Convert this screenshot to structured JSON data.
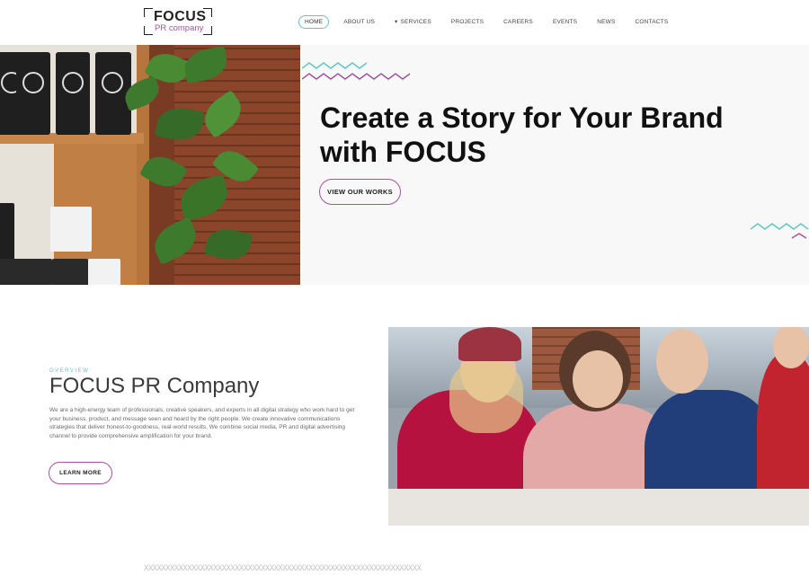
{
  "brand": {
    "name": "FOCUS",
    "tagline": "PR company",
    "accent_purple": "#a2559b",
    "accent_teal": "#5fc6c2"
  },
  "nav": {
    "items": [
      {
        "label": "HOME",
        "active": true
      },
      {
        "label": "ABOUT US"
      },
      {
        "label": "SERVICES",
        "has_dropdown": true
      },
      {
        "label": "PROJECTS"
      },
      {
        "label": "CAREERS"
      },
      {
        "label": "EVENTS"
      },
      {
        "label": "NEWS"
      },
      {
        "label": "CONTACTS"
      }
    ],
    "services_caret": "▾"
  },
  "hero": {
    "title": "Create a Story for Your Brand with FOCUS",
    "cta_label": "VIEW OUR WORKS",
    "image_alt_icon": "coffee-shop-shelf-image"
  },
  "overview": {
    "eyebrow": "OVERVIEW",
    "title": "FOCUS PR Company",
    "body": "We are a high-energy team of professionals, creative speakers, and experts in all digital strategy who work hard to get your business, product, and message seen and heard by the right people. We create innovative communications strategies that deliver honest-to-goodness, real-world results. We combine social media, PR and digital advertising channel to provide comprehensive amplification for your brand.",
    "cta_label": "LEARN MORE",
    "image_icon": "team-meeting-image"
  },
  "divider": {
    "pattern": "XXXXXXXXXXXXXXXXXXXXXXXXXXXXXXXXXXXXXXXXXXXXXXXXXXXXXXXXXXXXXXXX"
  }
}
